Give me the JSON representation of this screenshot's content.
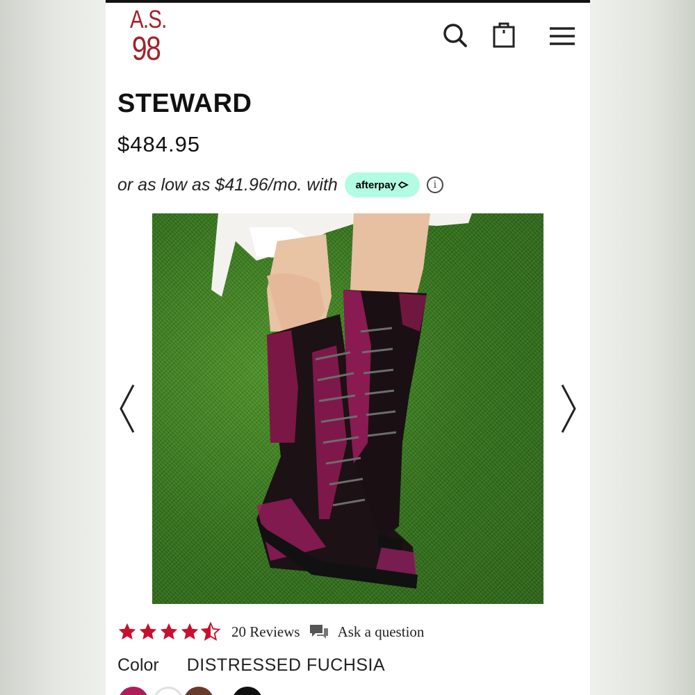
{
  "brand": {
    "logo_line1": "A.S.",
    "logo_line2": "98",
    "color": "#a3212b"
  },
  "header": {
    "icons": [
      "search-icon",
      "shopping-bag-icon",
      "menu-icon"
    ]
  },
  "product": {
    "name": "STEWARD",
    "price": "$484.95",
    "image_subject": "product-photo-boots"
  },
  "afterpay": {
    "text": "or as low as $41.96/mo. with",
    "badge_label": "afterpay",
    "badge_color": "#b2fce4"
  },
  "gallery": {
    "prev_icon": "chevron-left-icon",
    "next_icon": "chevron-right-icon"
  },
  "reviews": {
    "rating": 4.5,
    "max_rating": 5,
    "star_color": "#c8102e",
    "count_label": "20 Reviews",
    "ask_label": "Ask a question"
  },
  "color": {
    "label": "Color",
    "selected_value": "DISTRESSED FUCHSIA",
    "swatch_colors": [
      "#b01e5a",
      "#ffffff",
      "#6b3a2a",
      "#111111"
    ]
  }
}
